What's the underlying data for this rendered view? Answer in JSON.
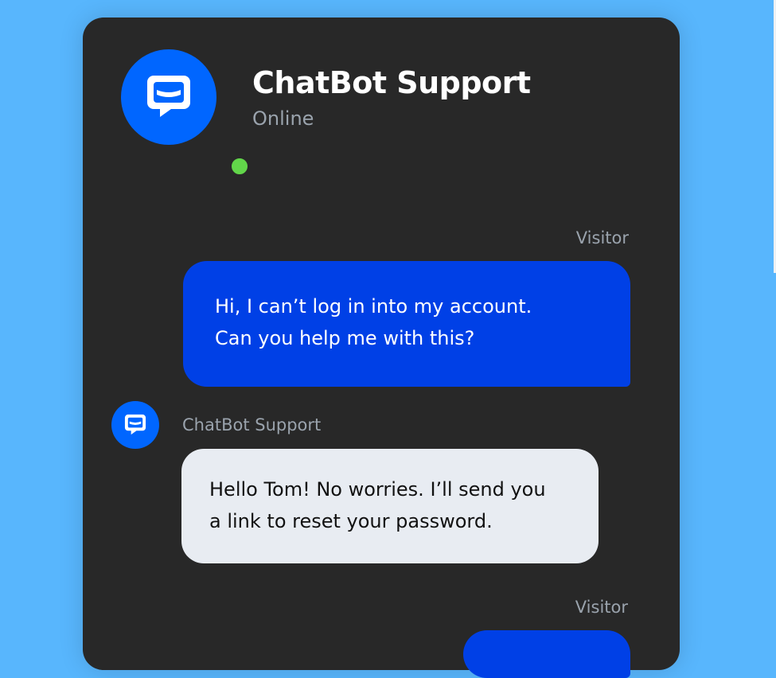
{
  "header": {
    "title": "ChatBot Support",
    "status": "Online",
    "status_color": "#62d64a",
    "avatar_icon": "chatbot-logo-icon"
  },
  "messages": [
    {
      "sender": "Visitor",
      "lines": [
        "Hi, I can’t log in into my account.",
        "Can you help me with this?"
      ]
    },
    {
      "sender": "ChatBot Support",
      "lines": [
        "Hello Tom! No worries. I’ll send you",
        "a link to reset your password."
      ]
    },
    {
      "sender": "Visitor",
      "lines": []
    }
  ],
  "colors": {
    "brand": "#0066ff",
    "visitor_bubble": "#0040e6",
    "bot_bubble": "#e8ecf2",
    "background": "#58b6fd",
    "card": "#282828"
  }
}
